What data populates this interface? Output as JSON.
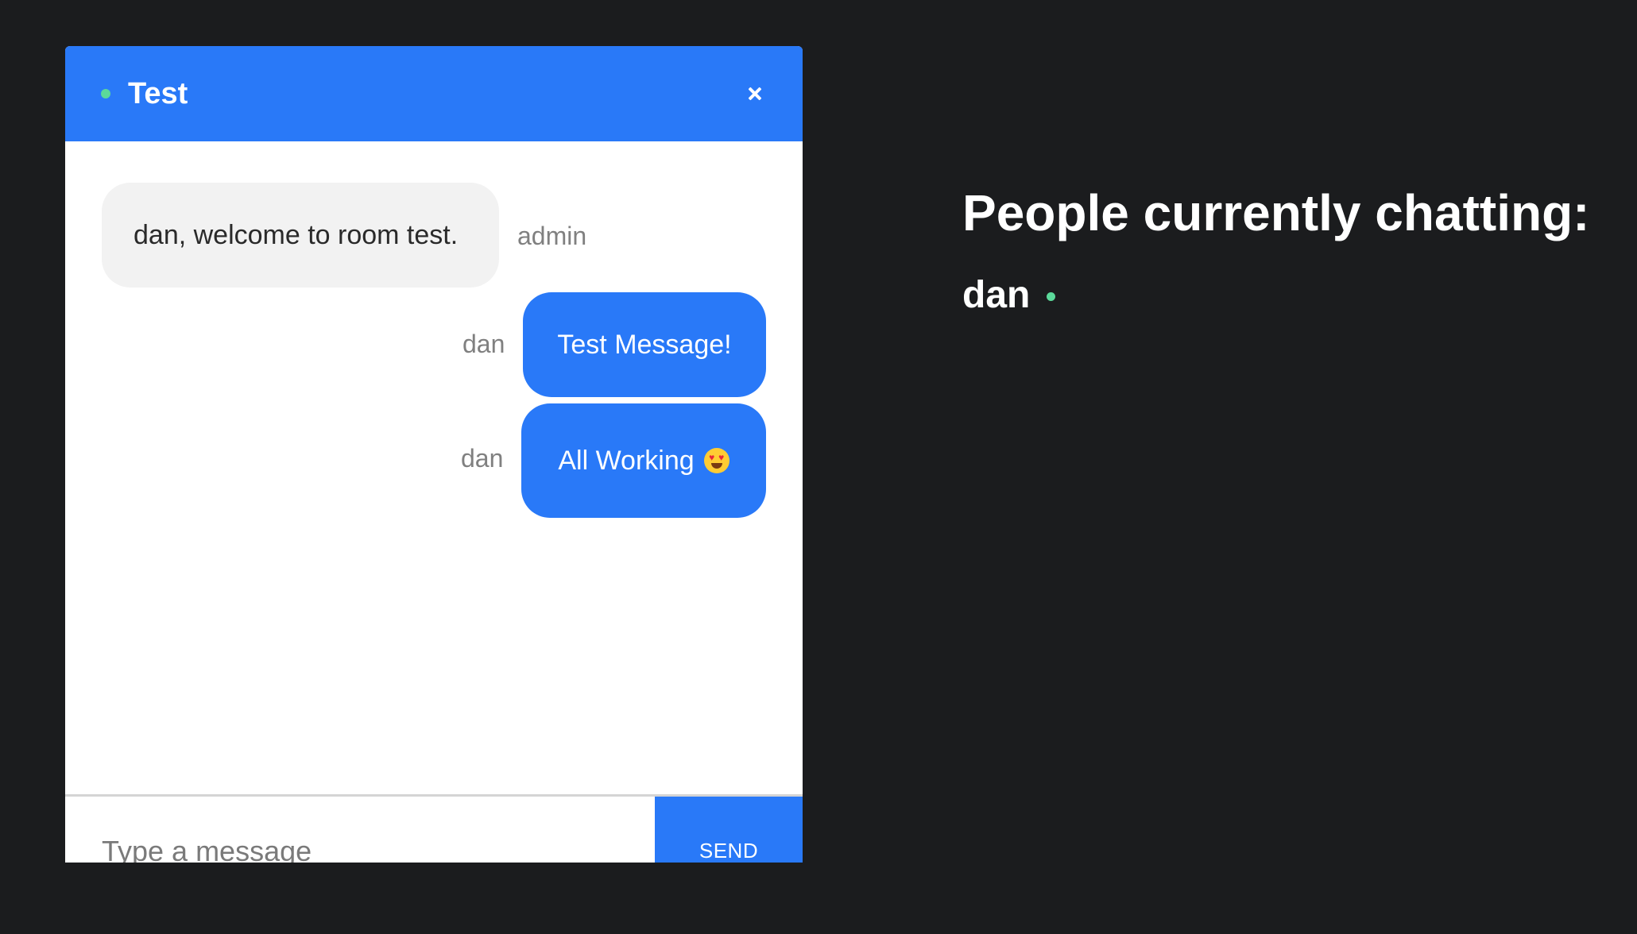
{
  "chat": {
    "room_name": "Test",
    "messages": [
      {
        "sender": "admin",
        "text": "dan, welcome to room test.",
        "direction": "incoming"
      },
      {
        "sender": "dan",
        "text": "Test Message!",
        "direction": "outgoing"
      },
      {
        "sender": "dan",
        "text": "All Working",
        "direction": "outgoing",
        "emoji": "heart-eyes-emoji"
      }
    ],
    "input": {
      "placeholder": "Type a message",
      "value": ""
    },
    "send_label": "SEND"
  },
  "people": {
    "title": "People currently chatting:",
    "users": [
      {
        "name": "dan",
        "status": "online"
      }
    ]
  },
  "colors": {
    "background": "#1b1c1e",
    "accent": "#2979f8",
    "online": "#5bd99a",
    "incoming_bubble": "#f2f2f2"
  },
  "icons": [
    "online-status-dot",
    "close-icon",
    "heart-eyes-emoji"
  ]
}
